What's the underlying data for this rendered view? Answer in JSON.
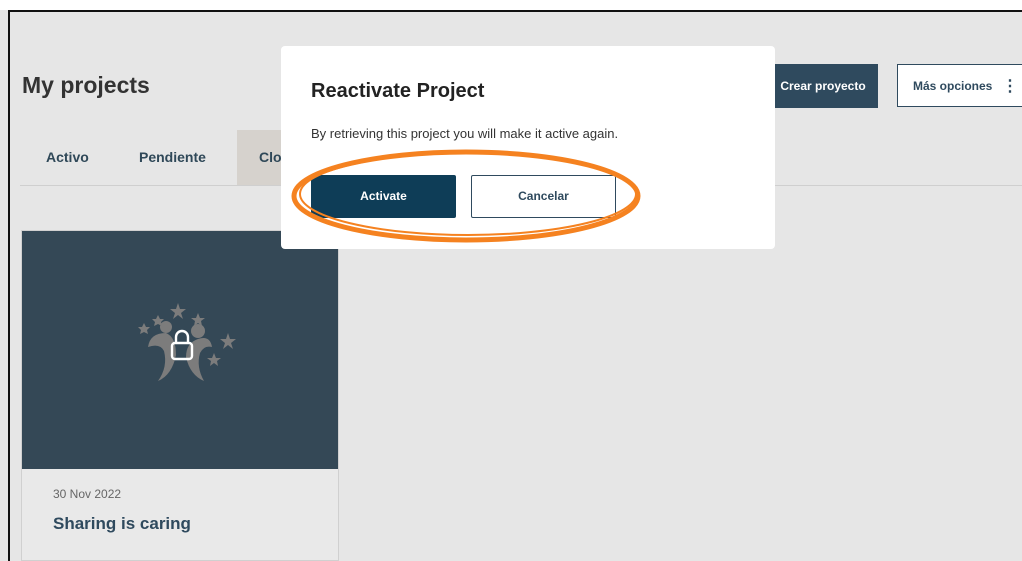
{
  "page": {
    "title": "My projects"
  },
  "header_actions": {
    "create_label": "Crear proyecto",
    "more_label": "Más opciones",
    "more_icon": "vertical-dots-icon"
  },
  "tabs": [
    {
      "label": "Activo",
      "active": false
    },
    {
      "label": "Pendiente",
      "active": false
    },
    {
      "label": "Clo",
      "active": true
    }
  ],
  "project_card": {
    "date": "30 Nov 2022",
    "title": "Sharing is caring",
    "icon": "lock-icon",
    "menu_icon": "more-options-icon"
  },
  "modal": {
    "title": "Reactivate Project",
    "body": "By retrieving this project you will make it active again.",
    "activate_label": "Activate",
    "cancel_label": "Cancelar"
  },
  "colors": {
    "primary": "#0e3d57",
    "card_bg": "#344856",
    "annotation": "#f58220"
  }
}
